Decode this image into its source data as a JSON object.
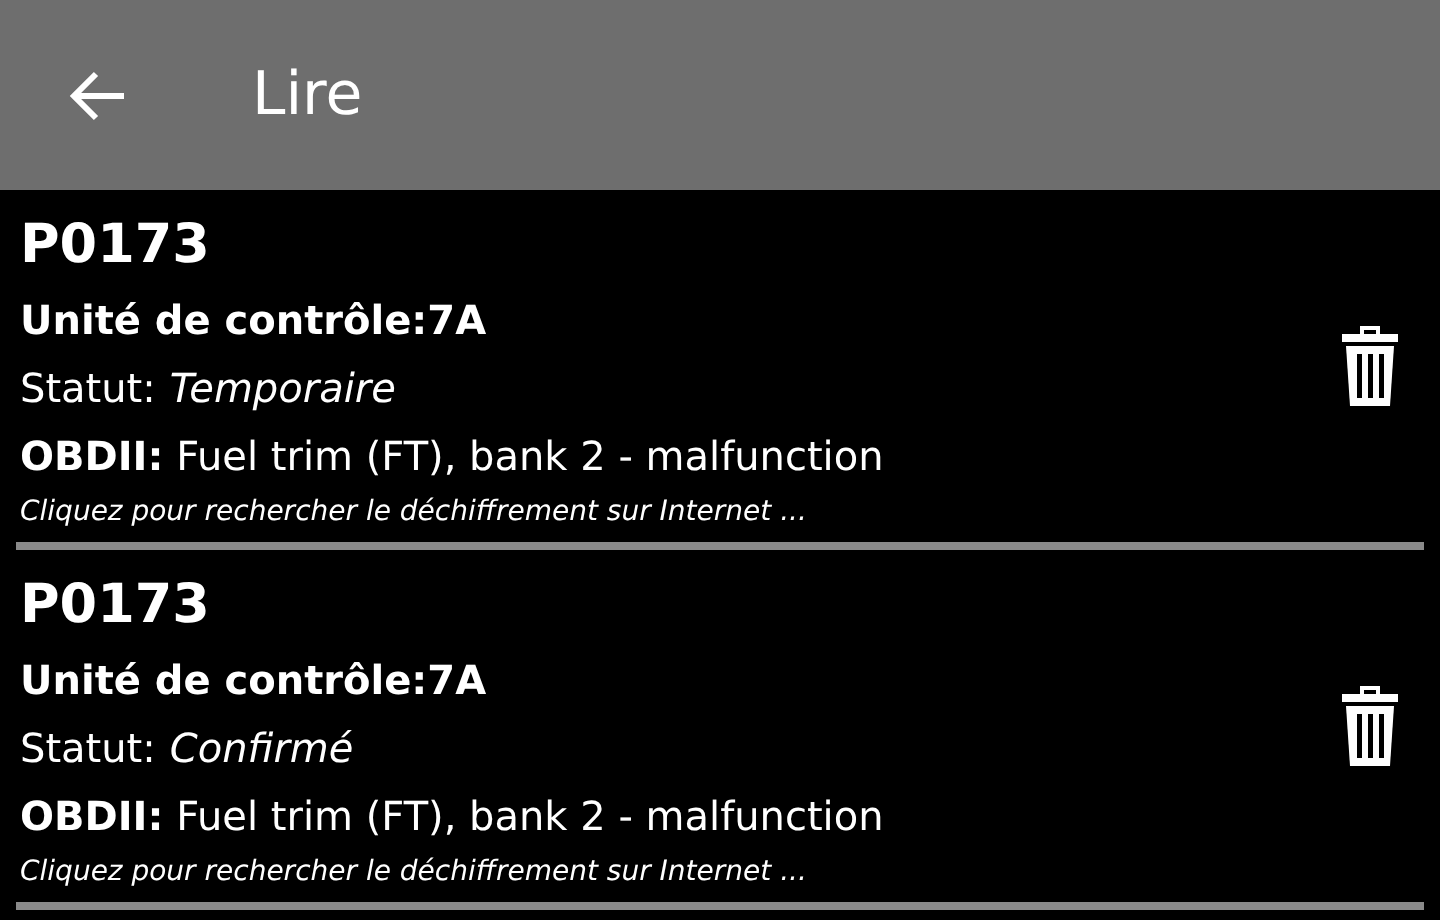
{
  "header": {
    "title": "Lire"
  },
  "codes": [
    {
      "code": "P0173",
      "unit": "Unité de contrôle:7A",
      "status_label": "Statut:",
      "status": "Temporaire",
      "description": "**OBDII:** Fuel trim (FT), bank 2 - malfunction",
      "hint": "Cliquez pour rechercher le déchiffrement sur Internet ..."
    },
    {
      "code": "P0173",
      "unit": "Unité de contrôle:7A",
      "status_label": "Statut:",
      "status": "Confirmé",
      "description": "**OBDII:** Fuel trim (FT), bank 2 - malfunction",
      "hint": "Cliquez pour rechercher le déchiffrement sur Internet ..."
    }
  ]
}
